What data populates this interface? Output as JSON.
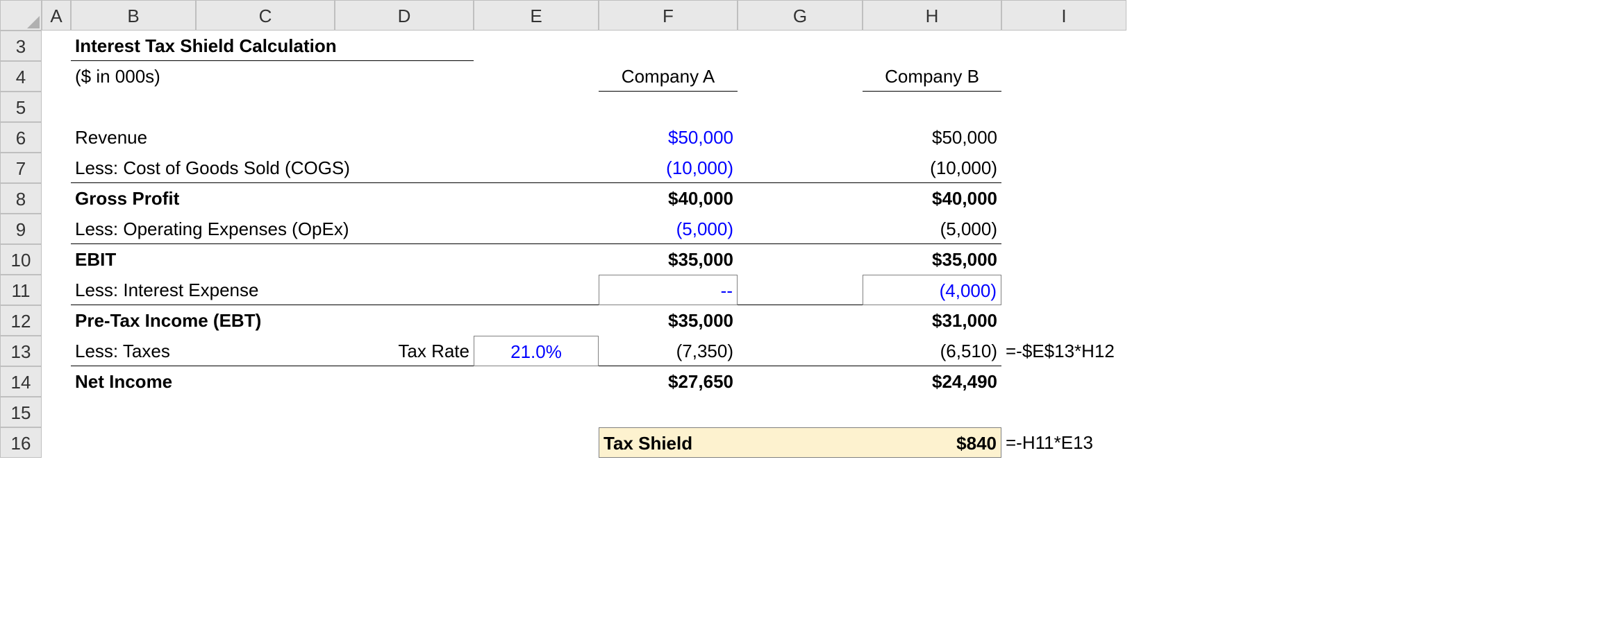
{
  "columns": [
    "A",
    "B",
    "C",
    "D",
    "E",
    "F",
    "G",
    "H",
    "I"
  ],
  "rows": [
    "3",
    "4",
    "5",
    "6",
    "7",
    "8",
    "9",
    "10",
    "11",
    "12",
    "13",
    "14",
    "15",
    "16"
  ],
  "title": "Interest Tax Shield Calculation",
  "units": "($ in 000s)",
  "company_a": "Company A",
  "company_b": "Company B",
  "lines": {
    "revenue": {
      "label": "Revenue",
      "a": "$50,000",
      "b": "$50,000"
    },
    "cogs": {
      "label": "Less: Cost of Goods Sold (COGS)",
      "a": "(10,000)",
      "b": "(10,000)"
    },
    "gross": {
      "label": "Gross Profit",
      "a": "$40,000",
      "b": "$40,000"
    },
    "opex": {
      "label": "Less: Operating Expenses (OpEx)",
      "a": "(5,000)",
      "b": "(5,000)"
    },
    "ebit": {
      "label": "EBIT",
      "a": "$35,000",
      "b": "$35,000"
    },
    "int": {
      "label": "Less: Interest Expense",
      "a": "--",
      "b": "(4,000)"
    },
    "ebt": {
      "label": "Pre-Tax Income (EBT)",
      "a": "$35,000",
      "b": "$31,000"
    },
    "tax": {
      "label": "Less: Taxes",
      "rate_label": "Tax Rate",
      "rate": "21.0%",
      "a": "(7,350)",
      "b": "(6,510)"
    },
    "ni": {
      "label": "Net Income",
      "a": "$27,650",
      "b": "$24,490"
    },
    "shield": {
      "label": "Tax Shield",
      "b": "$840"
    }
  },
  "formulas": {
    "tax_b": "=-$E$13*H12",
    "shield_b": "=-H11*E13"
  }
}
